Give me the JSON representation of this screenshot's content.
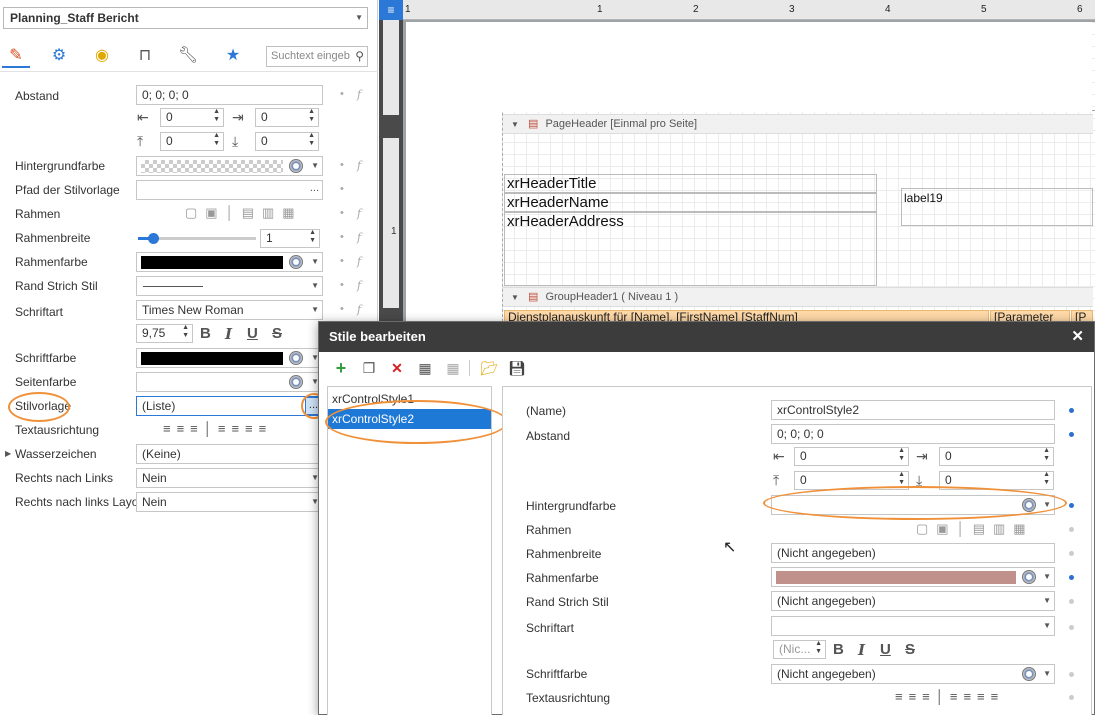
{
  "left_panel": {
    "report_combo": "Planning_Staff  Bericht",
    "search_placeholder": "Suchtext eingeb",
    "props": {
      "abstand": {
        "label": "Abstand",
        "value": "0; 0; 0; 0",
        "left": "0",
        "right": "0",
        "top": "0",
        "bottom": "0"
      },
      "hintergrundfarbe": {
        "label": "Hintergrundfarbe"
      },
      "pfad": {
        "label": "Pfad der Stilvorlage",
        "button": "..."
      },
      "rahmen": {
        "label": "Rahmen"
      },
      "rahmenbreite": {
        "label": "Rahmenbreite",
        "value": "1"
      },
      "rahmenfarbe": {
        "label": "Rahmenfarbe"
      },
      "randstrich": {
        "label": "Rand Strich Stil"
      },
      "schriftart": {
        "label": "Schriftart",
        "value": "Times New Roman",
        "size": "9,75",
        "bold": "B",
        "italic": "I",
        "underline": "U",
        "strike": "S"
      },
      "schriftfarbe": {
        "label": "Schriftfarbe"
      },
      "seitenfarbe": {
        "label": "Seitenfarbe"
      },
      "stilvorlage": {
        "label": "Stilvorlage",
        "value": "(Liste)",
        "button": "..."
      },
      "textausrichtung": {
        "label": "Textausrichtung"
      },
      "wasserzeichen": {
        "label": "Wasserzeichen",
        "value": "(Keine)"
      },
      "rechts_links": {
        "label": "Rechts nach Links",
        "value": "Nein"
      },
      "rechts_links_layout": {
        "label": "Rechts nach links Layout",
        "value": "Nein"
      }
    }
  },
  "designer": {
    "ruler_marks": [
      "1",
      "1",
      "2",
      "3",
      "4",
      "5",
      "6"
    ],
    "left_ruler_marks": [
      "1"
    ],
    "page_header_band": "PageHeader [Einmal pro Seite]",
    "group_header_band": "GroupHeader1 ( Niveau 1 )",
    "labels": [
      "xrHeaderTitle",
      "xrHeaderName",
      "xrHeaderAddress"
    ],
    "label19": "label19",
    "group_row_text": "Dienstplanauskunft für [Name], [FirstName] [StaffNum]",
    "group_row_text2": "[Parameter",
    "group_row_text3": "[P"
  },
  "dialog": {
    "title": "Stile bearbeiten",
    "close": "✕",
    "styles": [
      "xrControlStyle1",
      "xrControlStyle2"
    ],
    "selected_style": "xrControlStyle2",
    "fields": {
      "name": {
        "label": "(Name)",
        "value": "xrControlStyle2"
      },
      "abstand": {
        "label": "Abstand",
        "value": "0; 0; 0; 0",
        "left": "0",
        "right": "0",
        "top": "0",
        "bottom": "0"
      },
      "hintergrundfarbe": {
        "label": "Hintergrundfarbe"
      },
      "rahmen": {
        "label": "Rahmen"
      },
      "rahmenbreite": {
        "label": "Rahmenbreite",
        "value": "(Nicht angegeben)"
      },
      "rahmenfarbe": {
        "label": "Rahmenfarbe",
        "color": "#c0908a"
      },
      "randstrich": {
        "label": "Rand Strich Stil",
        "value": "(Nicht angegeben)"
      },
      "schriftart": {
        "label": "Schriftart",
        "value": "",
        "size": "(Nic...",
        "bold": "B",
        "italic": "I",
        "underline": "U",
        "strike": "S"
      },
      "schriftfarbe": {
        "label": "Schriftfarbe",
        "value": "(Nicht angegeben)"
      },
      "textausrichtung": {
        "label": "Textausrichtung"
      }
    }
  },
  "colors": {
    "accent": "#2b78d6",
    "highlight_ring": "#f0913a",
    "selection": "#1e78d6"
  }
}
